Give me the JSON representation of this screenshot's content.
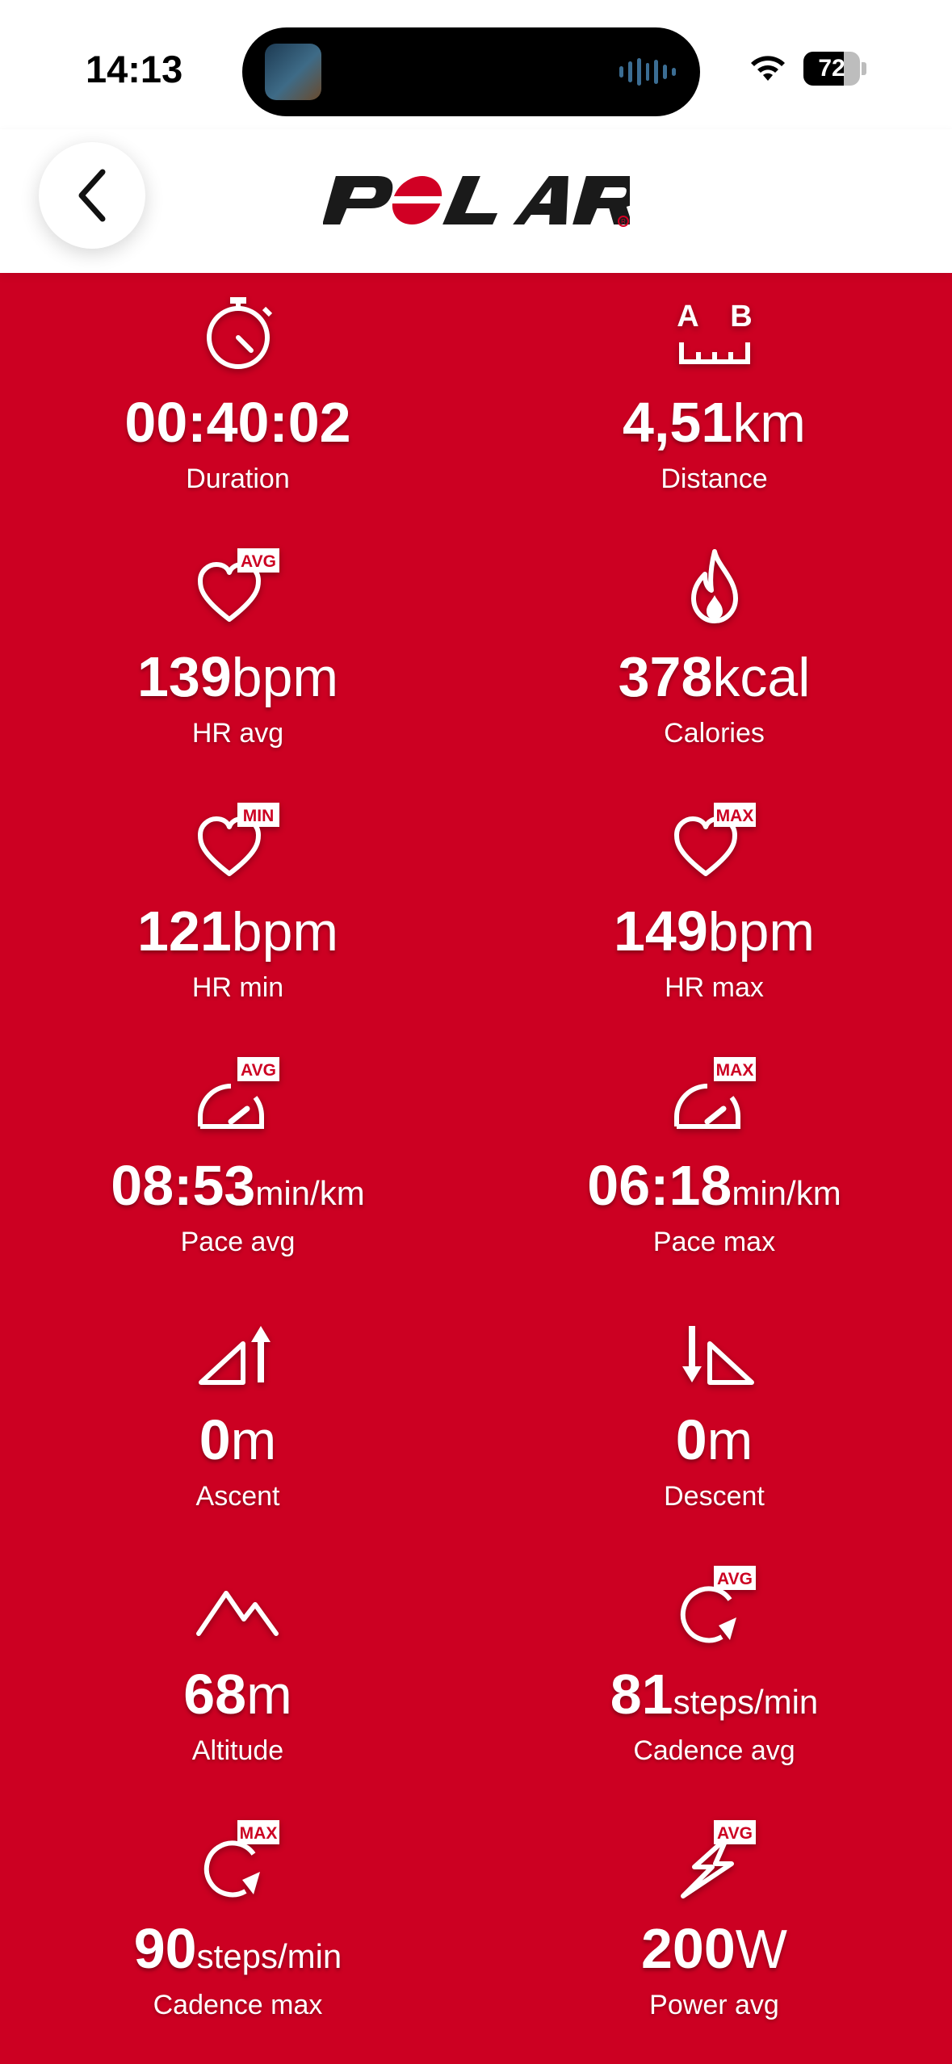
{
  "status_bar": {
    "time": "14:13",
    "battery": "72",
    "battery_level": 0.72
  },
  "header": {
    "logo_text": "POLAR"
  },
  "colors": {
    "background": "#cc0022",
    "header": "#ffffff",
    "text": "#ffffff"
  },
  "metrics": [
    {
      "icon": "stopwatch-icon",
      "value": "00:40:02",
      "unit": "",
      "label": "Duration"
    },
    {
      "icon": "distance-icon",
      "value": "4,51",
      "unit": "km",
      "label": "Distance",
      "icon_text_a": "A",
      "icon_text_b": "B"
    },
    {
      "icon": "heart-avg-icon",
      "value": "139",
      "unit": "bpm",
      "label": "HR avg",
      "badge": "AVG"
    },
    {
      "icon": "flame-icon",
      "value": "378",
      "unit": "kcal",
      "label": "Calories"
    },
    {
      "icon": "heart-min-icon",
      "value": "121",
      "unit": "bpm",
      "label": "HR min",
      "badge": "MIN"
    },
    {
      "icon": "heart-max-icon",
      "value": "149",
      "unit": "bpm",
      "label": "HR max",
      "badge": "MAX"
    },
    {
      "icon": "speedometer-avg-icon",
      "value": "08:53",
      "unit": "min/km",
      "label": "Pace avg",
      "badge": "AVG"
    },
    {
      "icon": "speedometer-max-icon",
      "value": "06:18",
      "unit": "min/km",
      "label": "Pace max",
      "badge": "MAX"
    },
    {
      "icon": "ascent-icon",
      "value": "0",
      "unit": "m",
      "label": "Ascent"
    },
    {
      "icon": "descent-icon",
      "value": "0",
      "unit": "m",
      "label": "Descent"
    },
    {
      "icon": "mountain-icon",
      "value": "68",
      "unit": "m",
      "label": "Altitude"
    },
    {
      "icon": "cadence-avg-icon",
      "value": "81",
      "unit": "steps/min",
      "label": "Cadence avg",
      "badge": "AVG"
    },
    {
      "icon": "cadence-max-icon",
      "value": "90",
      "unit": "steps/min",
      "label": "Cadence max",
      "badge": "MAX"
    },
    {
      "icon": "power-avg-icon",
      "value": "200",
      "unit": "W",
      "label": "Power avg",
      "badge": "AVG"
    }
  ]
}
